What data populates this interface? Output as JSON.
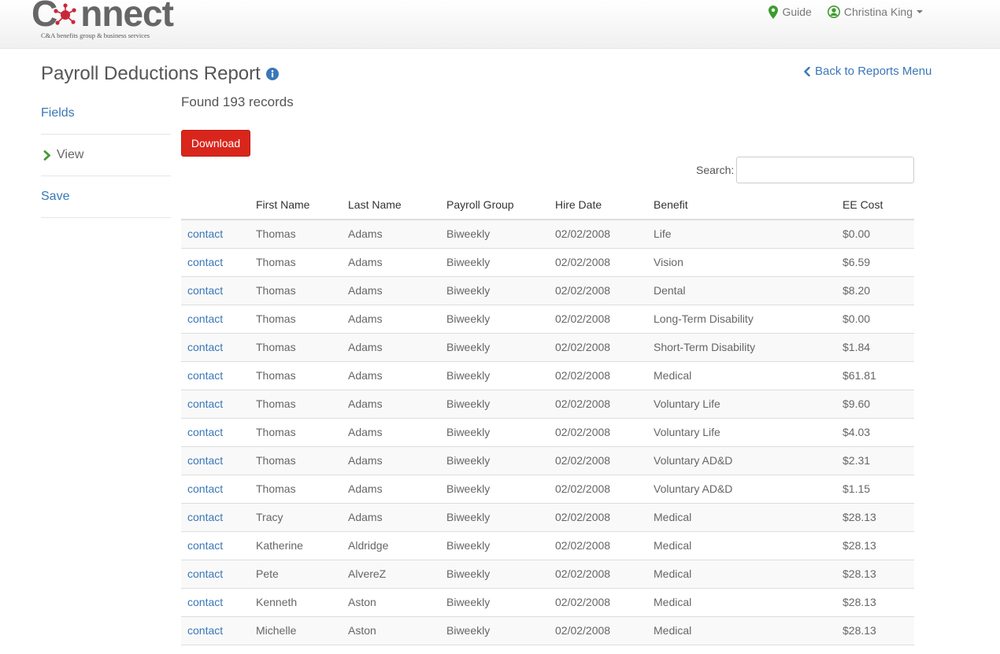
{
  "brand": {
    "logo_text_before": "C",
    "logo_text_after": "nnect",
    "tagline": "C&A benefits group & business services"
  },
  "nav": {
    "guide_label": "Guide",
    "user_label": "Christina King"
  },
  "page": {
    "title": "Payroll Deductions Report",
    "back_label": "Back to Reports Menu",
    "found_text": "Found 193 records",
    "download_label": "Download",
    "search_label": "Search:",
    "search_value": ""
  },
  "sidebar": {
    "items": [
      {
        "label": "Fields",
        "active": false
      },
      {
        "label": "View",
        "active": true
      },
      {
        "label": "Save",
        "active": false
      }
    ]
  },
  "table": {
    "columns": [
      "",
      "First Name",
      "Last Name",
      "Payroll Group",
      "Hire Date",
      "Benefit",
      "EE Cost"
    ],
    "rows": [
      [
        "contact",
        "Thomas",
        "Adams",
        "Biweekly",
        "02/02/2008",
        "Life",
        "$0.00"
      ],
      [
        "contact",
        "Thomas",
        "Adams",
        "Biweekly",
        "02/02/2008",
        "Vision",
        "$6.59"
      ],
      [
        "contact",
        "Thomas",
        "Adams",
        "Biweekly",
        "02/02/2008",
        "Dental",
        "$8.20"
      ],
      [
        "contact",
        "Thomas",
        "Adams",
        "Biweekly",
        "02/02/2008",
        "Long-Term Disability",
        "$0.00"
      ],
      [
        "contact",
        "Thomas",
        "Adams",
        "Biweekly",
        "02/02/2008",
        "Short-Term Disability",
        "$1.84"
      ],
      [
        "contact",
        "Thomas",
        "Adams",
        "Biweekly",
        "02/02/2008",
        "Medical",
        "$61.81"
      ],
      [
        "contact",
        "Thomas",
        "Adams",
        "Biweekly",
        "02/02/2008",
        "Voluntary Life",
        "$9.60"
      ],
      [
        "contact",
        "Thomas",
        "Adams",
        "Biweekly",
        "02/02/2008",
        "Voluntary Life",
        "$4.03"
      ],
      [
        "contact",
        "Thomas",
        "Adams",
        "Biweekly",
        "02/02/2008",
        "Voluntary AD&D",
        "$2.31"
      ],
      [
        "contact",
        "Thomas",
        "Adams",
        "Biweekly",
        "02/02/2008",
        "Voluntary AD&D",
        "$1.15"
      ],
      [
        "contact",
        "Tracy",
        "Adams",
        "Biweekly",
        "02/02/2008",
        "Medical",
        "$28.13"
      ],
      [
        "contact",
        "Katherine",
        "Aldridge",
        "Biweekly",
        "02/02/2008",
        "Medical",
        "$28.13"
      ],
      [
        "contact",
        "Pete",
        "AlvereZ",
        "Biweekly",
        "02/02/2008",
        "Medical",
        "$28.13"
      ],
      [
        "contact",
        "Kenneth",
        "Aston",
        "Biweekly",
        "02/02/2008",
        "Medical",
        "$28.13"
      ],
      [
        "contact",
        "Michelle",
        "Aston",
        "Biweekly",
        "02/02/2008",
        "Medical",
        "$28.13"
      ]
    ]
  },
  "colors": {
    "accent": "#3a77b8",
    "danger": "#d9261c",
    "nav_icon": "#3f9b2e",
    "logo_red": "#c9273a"
  },
  "icons": {
    "guide": "map-marker-icon",
    "user": "user-circle-icon",
    "info": "info-circle-icon",
    "back": "chevron-left-icon",
    "active_item": "chevron-right-icon"
  }
}
